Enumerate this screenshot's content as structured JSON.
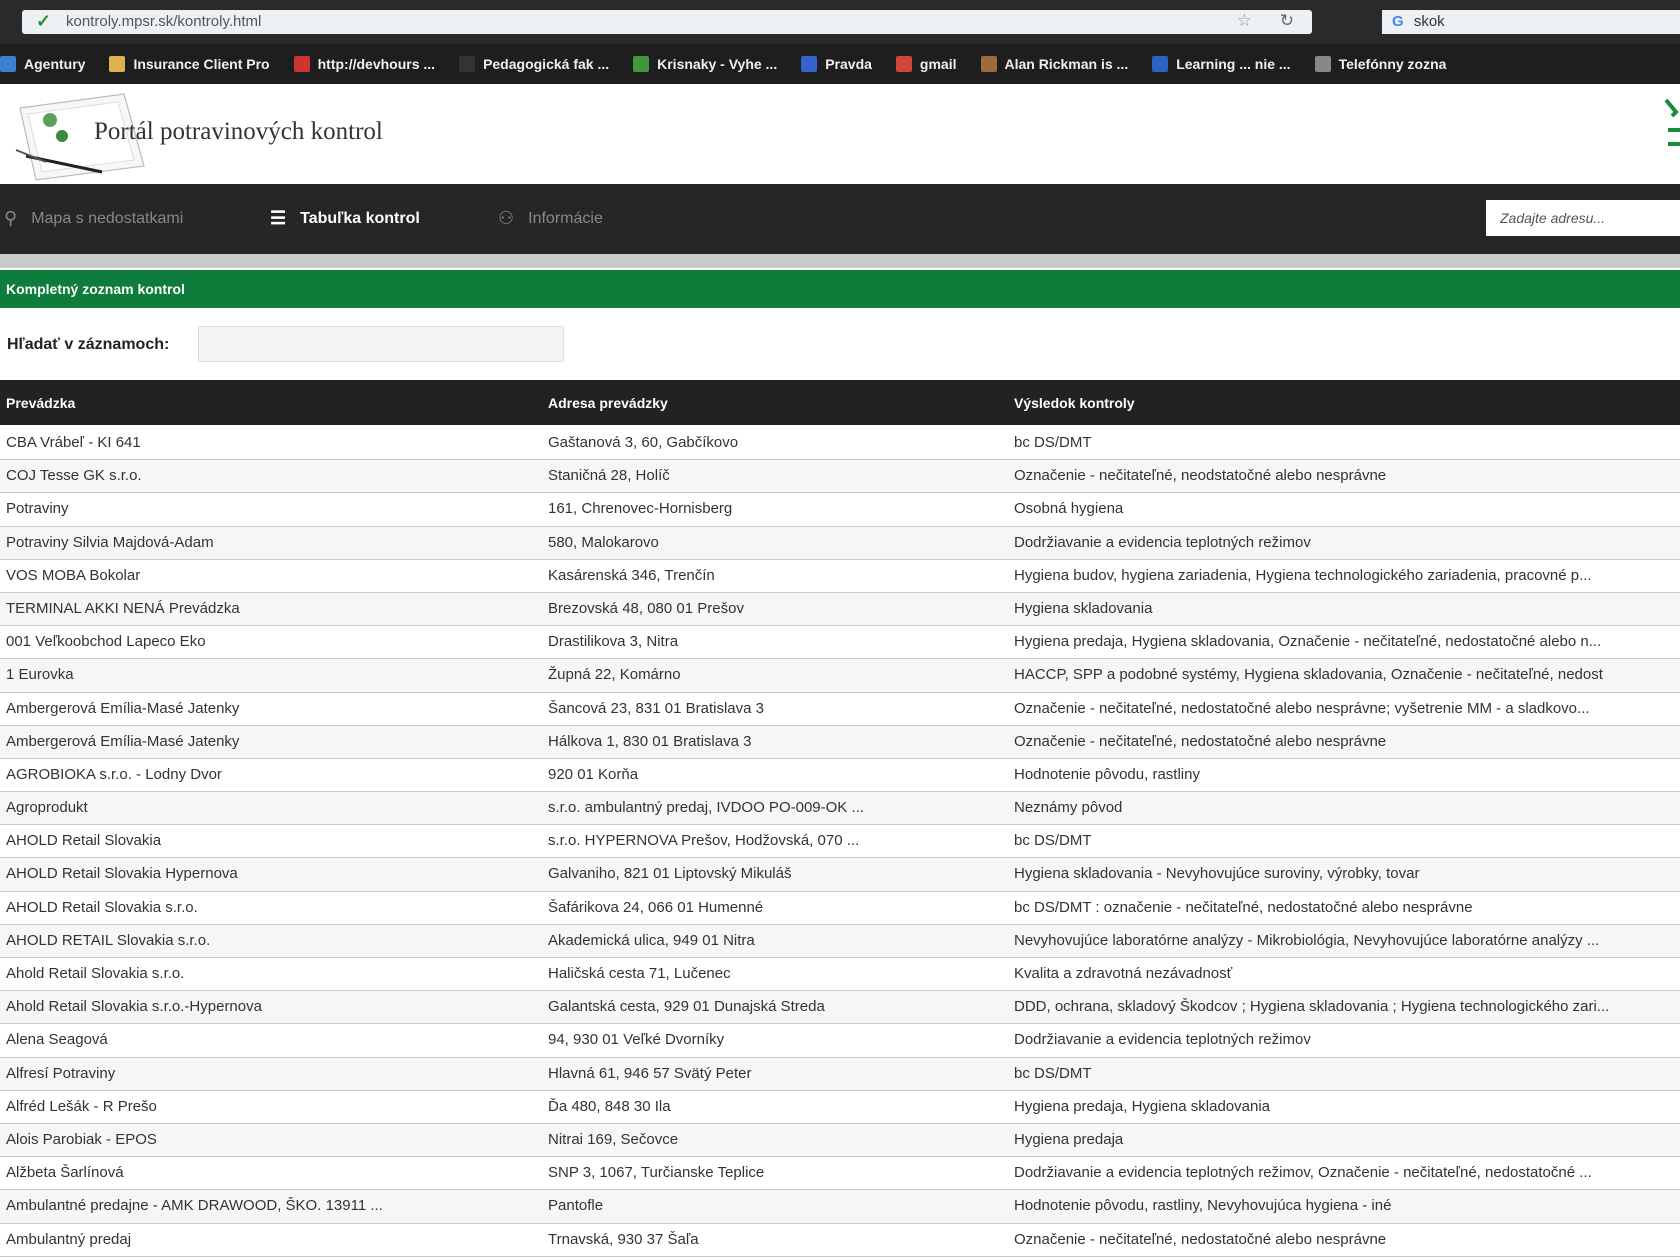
{
  "browser": {
    "url": "kontroly.mpsr.sk/kontroly.html",
    "search_text": "skok",
    "bookmarks": [
      {
        "label": "Agentury",
        "icon": "folder-icon",
        "color": "#3d7fd1"
      },
      {
        "label": "Insurance Client Pro",
        "icon": "app-icon",
        "color": "#e0b050"
      },
      {
        "label": "http://devhours ...",
        "icon": "page-icon",
        "color": "#cc3333"
      },
      {
        "label": "Pedagogická fak ...",
        "icon": "page-icon",
        "color": "#333333"
      },
      {
        "label": "Krisnaky - Vyhe ...",
        "icon": "leaf-icon",
        "color": "#3c9a3c"
      },
      {
        "label": "Pravda",
        "icon": "news-icon",
        "color": "#3366cc"
      },
      {
        "label": "gmail",
        "icon": "mail-icon",
        "color": "#d44638"
      },
      {
        "label": "Alan Rickman is ...",
        "icon": "photo-icon",
        "color": "#9c6b3f"
      },
      {
        "label": "Learning ... nie ...",
        "icon": "doc-icon",
        "color": "#2a65c4"
      },
      {
        "label": "Telefónny zozna",
        "icon": "globe-icon",
        "color": "#888888"
      }
    ]
  },
  "site": {
    "title": "Portál potravinových kontrol",
    "accent": "#0e7c3a"
  },
  "nav": {
    "map_label": "Mapa s nedostatkami",
    "table_label": "Tabuľka kontrol",
    "info_label": "Informácie",
    "search_placeholder": "Zadajte adresu..."
  },
  "section": {
    "title": "Kompletný zoznam kontrol"
  },
  "records_search": {
    "label": "Hľadať v záznamoch:",
    "value": ""
  },
  "table": {
    "headers": [
      "Prevádzka",
      "Adresa prevádzky",
      "Výsledok kontroly"
    ],
    "rows": [
      [
        "CBA Vrábeľ - KI 641",
        "Gaštanová 3, 60, Gabčíkovo",
        "bc DS/DMT"
      ],
      [
        "COJ Tesse GK s.r.o.",
        "Staničná 28, Holíč",
        "Označenie - nečitateľné, neodstatočné alebo nesprávne"
      ],
      [
        "Potraviny",
        "161, Chrenovec-Hornisberg",
        "Osobná hygiena"
      ],
      [
        "Potraviny Silvia Majdová-Adam",
        "580, Malokarovo",
        "Dodržiavanie a evidencia teplotných režimov"
      ],
      [
        "VOS MOBA Bokolar",
        "Kasárenská 346, Trenčín",
        "Hygiena budov, hygiena zariadenia, Hygiena technologického zariadenia, pracovné p..."
      ],
      [
        "TERMINAL AKKI NENÁ Prevádzka",
        "Brezovská 48, 080 01 Prešov",
        "Hygiena skladovania"
      ],
      [
        "001 Veľkoobchod Lapeco Eko",
        "Drastilikova 3, Nitra",
        "Hygiena predaja, Hygiena skladovania, Označenie - nečitateľné, nedostatočné alebo n..."
      ],
      [
        "1 Eurovka",
        "Župná 22, Komárno",
        "HACCP, SPP a podobné systémy, Hygiena skladovania, Označenie - nečitateľné, nedost"
      ],
      [
        "Ambergerová Emília-Masé Jatenky",
        "Šancová 23, 831 01 Bratislava 3",
        "Označenie - nečitateľné, nedostatočné alebo nesprávne; vyšetrenie MM - a sladkovo..."
      ],
      [
        "Ambergerová Emília-Masé Jatenky",
        "Hálkova 1, 830 01 Bratislava 3",
        "Označenie - nečitateľné, nedostatočné alebo nesprávne"
      ],
      [
        "AGROBIOKA s.r.o. - Lodny Dvor",
        "920 01 Korňa",
        "Hodnotenie pôvodu, rastliny"
      ],
      [
        "Agroprodukt",
        "s.r.o. ambulantný predaj, IVDOO PO-009-OK ...",
        "Neznámy pôvod"
      ],
      [
        "AHOLD Retail Slovakia",
        "s.r.o. HYPERNOVA Prešov, Hodžovská, 070 ...",
        "bc DS/DMT"
      ],
      [
        "AHOLD Retail Slovakia Hypernova",
        "Galvaniho, 821 01 Liptovský Mikuláš",
        "Hygiena skladovania - Nevyhovujúce suroviny, výrobky, tovar"
      ],
      [
        "AHOLD Retail Slovakia s.r.o.",
        "Šafárikova 24, 066 01 Humenné",
        "bc DS/DMT : označenie - nečitateľné, nedostatočné alebo nesprávne"
      ],
      [
        "AHOLD RETAIL Slovakia s.r.o.",
        "Akademická ulica, 949 01 Nitra",
        "Nevyhovujúce laboratórne analýzy - Mikrobiológia, Nevyhovujúce laboratórne analýzy ..."
      ],
      [
        "Ahold Retail Slovakia s.r.o.",
        "Haličská cesta 71, Lučenec",
        "Kvalita a zdravotná nezávadnosť"
      ],
      [
        "Ahold Retail Slovakia s.r.o.-Hypernova",
        "Galantská cesta, 929 01 Dunajská Streda",
        "DDD, ochrana, skladový Škodcov ; Hygiena skladovania ; Hygiena technologického zari..."
      ],
      [
        "Alena Seagová",
        "94, 930 01 Veľké Dvorníky",
        "Dodržiavanie a evidencia teplotných režimov"
      ],
      [
        "Alfresí Potraviny",
        "Hlavná 61, 946 57 Svätý Peter",
        "bc DS/DMT"
      ],
      [
        "Alfréd Lešák - R Prešo",
        "Ďa 480, 848 30 Ila",
        "Hygiena predaja, Hygiena skladovania"
      ],
      [
        "Alois Parobiak - EPOS",
        "Nitrai 169, Sečovce",
        "Hygiena predaja"
      ],
      [
        "Alžbeta Šarlínová",
        "SNP 3, 1067, Turčianske Teplice",
        "Dodržiavanie a evidencia teplotných režimov, Označenie - nečitateľné, nedostatočné ..."
      ],
      [
        "Ambulantné predajne - AMK DRAWOOD, ŠKO. 13911 ...",
        "Pantofle",
        "Hodnotenie pôvodu, rastliny, Nevyhovujúca hygiena - iné"
      ],
      [
        "Ambulantný predaj",
        "Trnavská, 930 37 Šaľa",
        "Označenie - nečitateľné, nedostatočné alebo nesprávne"
      ]
    ]
  }
}
